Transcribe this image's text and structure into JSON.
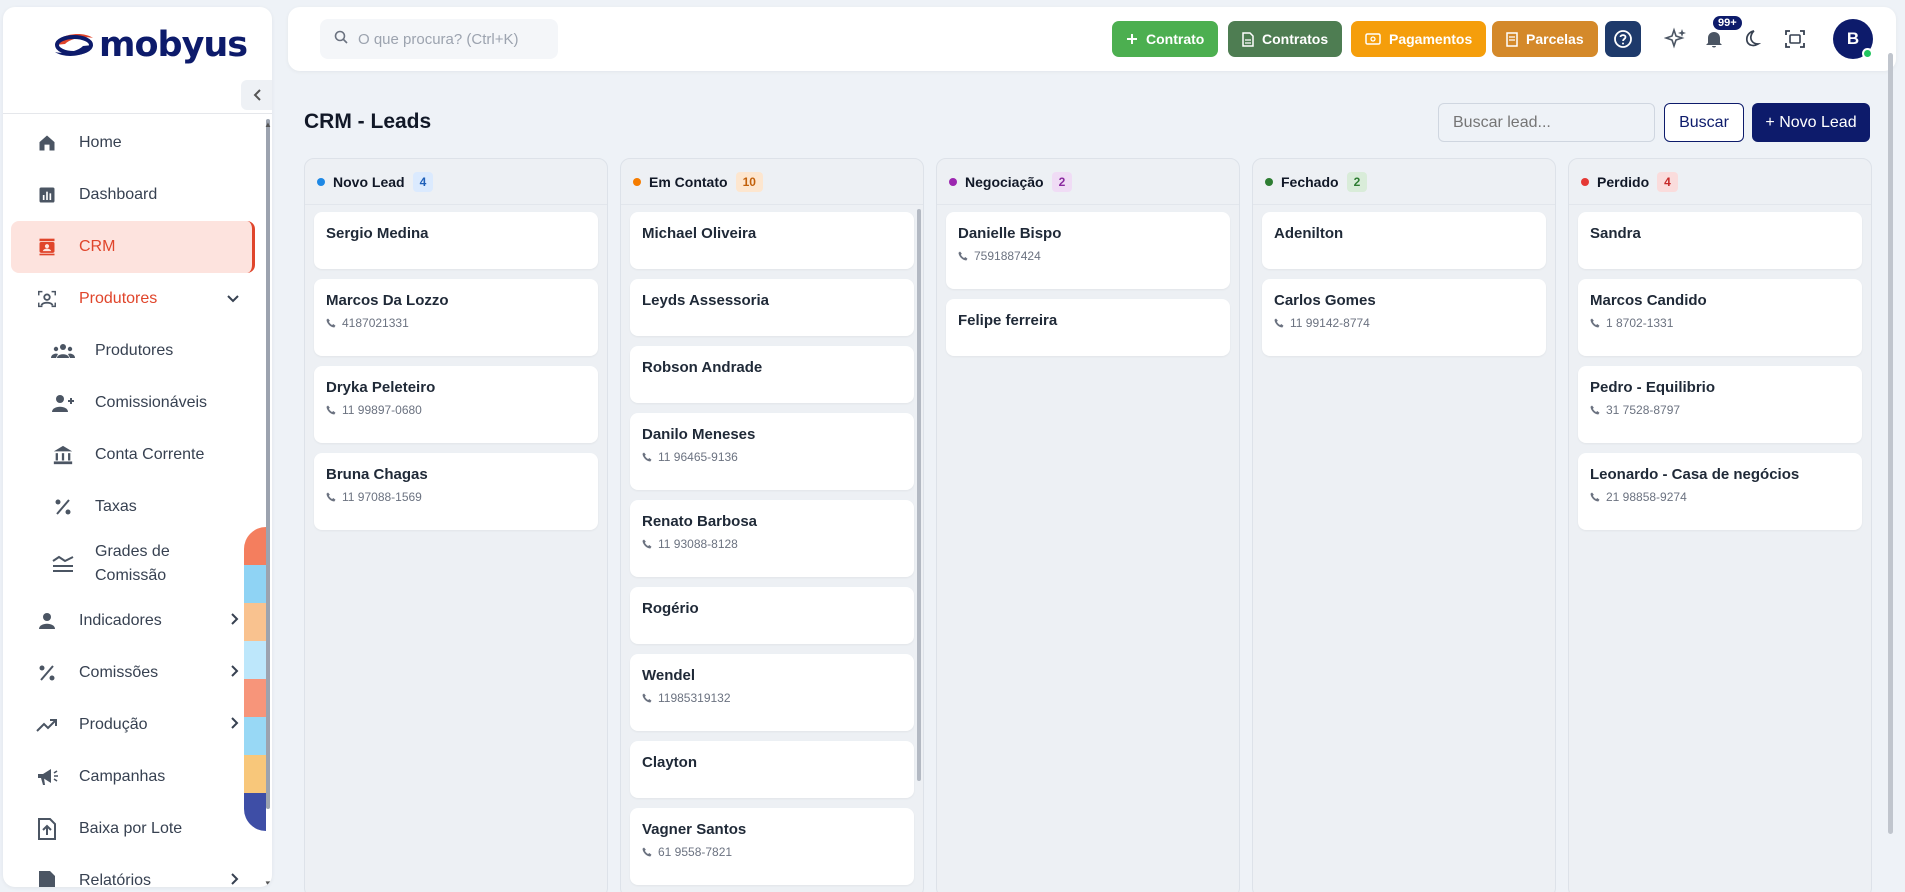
{
  "app": {
    "logo_text": "mobyus"
  },
  "sidebar": {
    "items": [
      {
        "label": "Home",
        "icon": "home-icon"
      },
      {
        "label": "Dashboard",
        "icon": "chart-bar-icon"
      },
      {
        "label": "CRM",
        "icon": "contact-card-icon",
        "active": true
      },
      {
        "label": "Produtores",
        "icon": "user-group-icon",
        "open": true
      },
      {
        "label": "Produtores",
        "icon": "users-icon",
        "sub": true
      },
      {
        "label": "Comissionáveis",
        "icon": "user-plus-icon",
        "sub": true
      },
      {
        "label": "Conta Corrente",
        "icon": "bank-icon",
        "sub": true
      },
      {
        "label": "Taxas",
        "icon": "percent-icon",
        "sub": true
      },
      {
        "label": "Grades de Comissão",
        "icon": "grid-lines-icon",
        "sub": true
      },
      {
        "label": "Indicadores",
        "icon": "person-icon",
        "chevron": true
      },
      {
        "label": "Comissões",
        "icon": "percent-icon",
        "chevron": true
      },
      {
        "label": "Produção",
        "icon": "trending-up-icon",
        "chevron": true
      },
      {
        "label": "Campanhas",
        "icon": "megaphone-icon"
      },
      {
        "label": "Baixa por Lote",
        "icon": "file-upload-icon"
      },
      {
        "label": "Relatórios",
        "icon": "report-icon",
        "chevron": true
      }
    ]
  },
  "header": {
    "search_placeholder": "O que procura? (Ctrl+K)",
    "buttons": [
      {
        "label": "Contrato",
        "color": "#4caf50"
      },
      {
        "label": "Contratos",
        "color": "#4e7d52"
      },
      {
        "label": "Pagamentos",
        "color": "#f59e0b"
      },
      {
        "label": "Parcelas",
        "color": "#d4892a"
      }
    ],
    "notification_count": "99+",
    "avatar_initial": "B"
  },
  "page": {
    "title": "CRM - Leads",
    "search_placeholder": "Buscar lead...",
    "search_button": "Buscar",
    "new_lead_button": "+ Novo Lead"
  },
  "columns": [
    {
      "title": "Novo Lead",
      "count": "4",
      "color": "#1e88e5",
      "badge_bg": "#dbeafe",
      "badge_fg": "#1e5fb8",
      "leads": [
        {
          "name": "Sergio Medina",
          "phone": ""
        },
        {
          "name": "Marcos Da Lozzo",
          "phone": "4187021331"
        },
        {
          "name": "Dryka Peleteiro",
          "phone": "11 99897-0680"
        },
        {
          "name": "Bruna Chagas",
          "phone": "11 97088-1569"
        }
      ]
    },
    {
      "title": "Em Contato",
      "count": "10",
      "color": "#f57c00",
      "badge_bg": "#fde6cf",
      "badge_fg": "#c2600a",
      "leads": [
        {
          "name": "Michael Oliveira",
          "phone": ""
        },
        {
          "name": "Leyds Assessoria",
          "phone": ""
        },
        {
          "name": "Robson Andrade",
          "phone": ""
        },
        {
          "name": "Danilo Meneses",
          "phone": "11 96465-9136"
        },
        {
          "name": "Renato Barbosa",
          "phone": "11 93088-8128"
        },
        {
          "name": "Rogério",
          "phone": ""
        },
        {
          "name": "Wendel",
          "phone": "11985319132"
        },
        {
          "name": "Clayton",
          "phone": ""
        },
        {
          "name": "Vagner Santos",
          "phone": "61 9558-7821"
        }
      ]
    },
    {
      "title": "Negociação",
      "count": "2",
      "color": "#9c27b0",
      "badge_bg": "#f0dcf5",
      "badge_fg": "#8a2a9f",
      "leads": [
        {
          "name": "Danielle Bispo",
          "phone": "7591887424"
        },
        {
          "name": "Felipe ferreira",
          "phone": ""
        }
      ]
    },
    {
      "title": "Fechado",
      "count": "2",
      "color": "#2e7d32",
      "badge_bg": "#d9ecd9",
      "badge_fg": "#2e7d32",
      "leads": [
        {
          "name": "Adenilton",
          "phone": ""
        },
        {
          "name": "Carlos Gomes",
          "phone": "11 99142-8774"
        }
      ]
    },
    {
      "title": "Perdido",
      "count": "4",
      "color": "#e53935",
      "badge_bg": "#fadcdc",
      "badge_fg": "#c62828",
      "leads": [
        {
          "name": "Sandra",
          "phone": ""
        },
        {
          "name": "Marcos Candido",
          "phone": "1 8702-1331"
        },
        {
          "name": "Pedro - Equilibrio",
          "phone": "31 7528-8797"
        },
        {
          "name": "Leonardo - Casa de negócios",
          "phone": "21 98858-9274"
        }
      ]
    }
  ]
}
